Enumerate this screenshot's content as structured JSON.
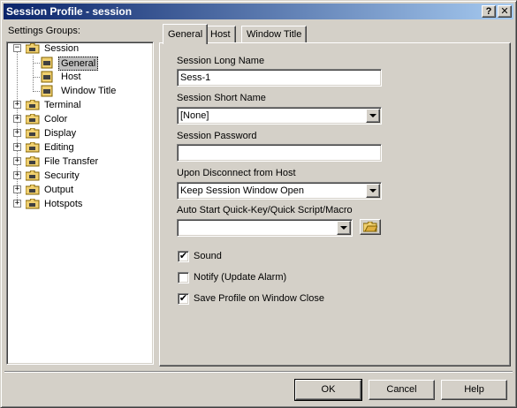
{
  "window": {
    "title": "Session Profile - session",
    "help_label": "?",
    "close_label": "✕"
  },
  "tree": {
    "label": "Settings Groups:",
    "items": [
      {
        "label": "Session",
        "expanded": true
      },
      {
        "label": "General"
      },
      {
        "label": "Host"
      },
      {
        "label": "Window Title"
      },
      {
        "label": "Terminal"
      },
      {
        "label": "Color"
      },
      {
        "label": "Display"
      },
      {
        "label": "Editing"
      },
      {
        "label": "File Transfer"
      },
      {
        "label": "Security"
      },
      {
        "label": "Output"
      },
      {
        "label": "Hotspots"
      }
    ],
    "expander_collapsed": "+",
    "expander_expanded": "−"
  },
  "tabs": [
    {
      "label": "General"
    },
    {
      "label": "Host"
    },
    {
      "label": "Window Title"
    }
  ],
  "form": {
    "long_name_label": "Session Long Name",
    "long_name_value": "Sess-1",
    "short_name_label": "Session Short Name",
    "short_name_value": "[None]",
    "password_label": "Session Password",
    "password_value": "",
    "disconnect_label": "Upon Disconnect from Host",
    "disconnect_value": "Keep Session Window Open",
    "autostart_label": "Auto Start Quick-Key/Quick Script/Macro",
    "autostart_value": ""
  },
  "options": {
    "sound": {
      "label": "Sound",
      "checked": true
    },
    "notify": {
      "label": "Notify (Update Alarm)",
      "checked": false
    },
    "save_profile": {
      "label": "Save Profile on Window Close",
      "checked": true
    }
  },
  "buttons": {
    "ok": "OK",
    "cancel": "Cancel",
    "help": "Help"
  },
  "colors": {
    "titlebar_start": "#0a246a",
    "titlebar_end": "#a6caf0",
    "face": "#d4d0c8",
    "folder": "#f0d070"
  }
}
